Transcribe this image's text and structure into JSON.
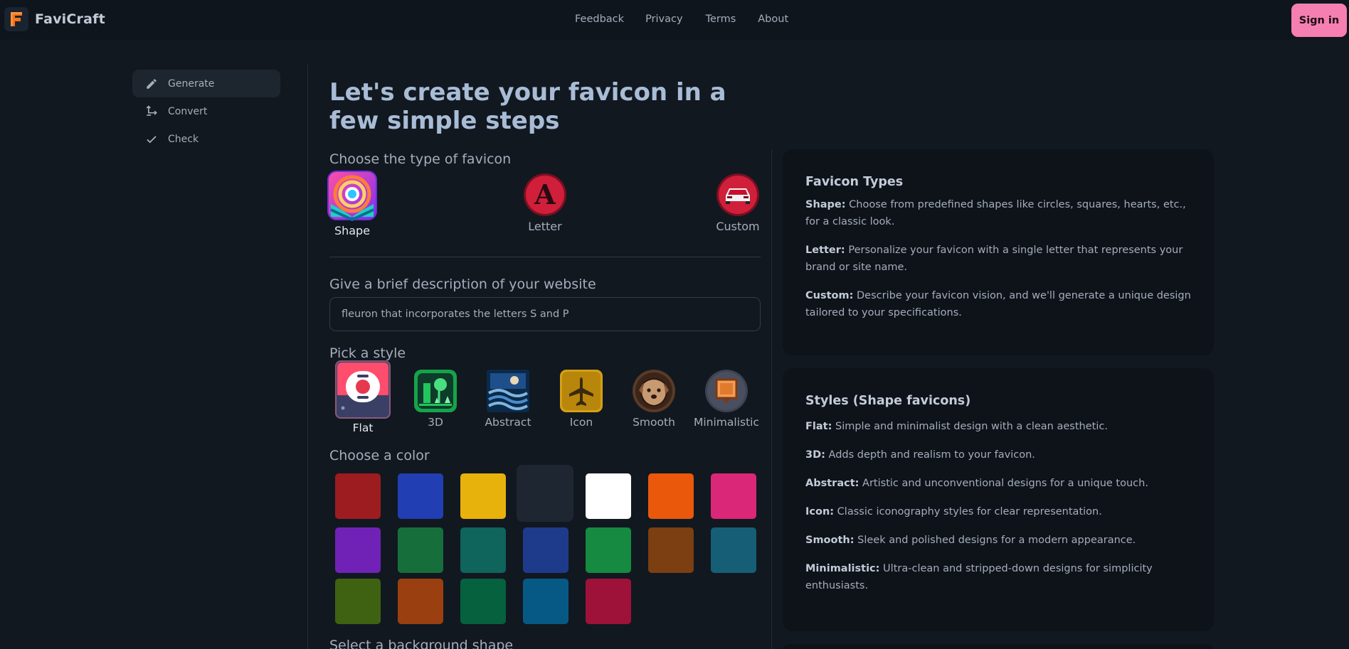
{
  "app": {
    "name": "FaviCraft"
  },
  "nav": {
    "links": [
      "Feedback",
      "Privacy",
      "Terms",
      "About"
    ],
    "signin": "Sign in"
  },
  "sidebar": {
    "items": [
      {
        "label": "Generate",
        "icon": "pencil-icon",
        "active": true
      },
      {
        "label": "Convert",
        "icon": "convert-arrows-icon",
        "active": false
      },
      {
        "label": "Check",
        "icon": "check-icon",
        "active": false
      }
    ]
  },
  "main": {
    "title": "Let's create your favicon in a few simple steps",
    "type_label": "Choose the type of favicon",
    "types": [
      {
        "label": "Shape",
        "selected": true
      },
      {
        "label": "Letter",
        "selected": false
      },
      {
        "label": "Custom",
        "selected": false
      }
    ],
    "description_label": "Give a brief description of your website",
    "description_value": "fleuron that incorporates the letters S and P",
    "style_label": "Pick a style",
    "styles": [
      {
        "label": "Flat",
        "selected": true
      },
      {
        "label": "3D",
        "selected": false
      },
      {
        "label": "Abstract",
        "selected": false
      },
      {
        "label": "Icon",
        "selected": false
      },
      {
        "label": "Smooth",
        "selected": false
      },
      {
        "label": "Minimalistic",
        "selected": false
      }
    ],
    "color_label": "Choose a color",
    "colors": [
      "#9d1c20",
      "#213eb3",
      "#e8b20c",
      "#1e2631",
      "#ffffff",
      "#ea580c",
      "#db2777",
      "#7022b6",
      "#166f3b",
      "#0f645c",
      "#1e3a8a",
      "#158a40",
      "#7b3f12",
      "#165e76",
      "#3f6212",
      "#9a3f0f",
      "#05613e",
      "#075985",
      "#9e1239"
    ],
    "selected_color": "#1e2631",
    "bg_shape_label": "Select a background shape"
  },
  "panel": {
    "types": {
      "title": "Favicon Types",
      "items": [
        {
          "term": "Shape:",
          "text": " Choose from predefined shapes like circles, squares, hearts, etc., for a classic look."
        },
        {
          "term": "Letter:",
          "text": " Personalize your favicon with a single letter that represents your brand or site name."
        },
        {
          "term": "Custom:",
          "text": " Describe your favicon vision, and we'll generate a unique design tailored to your specifications."
        }
      ]
    },
    "styles": {
      "title": "Styles (Shape favicons)",
      "items": [
        {
          "term": "Flat:",
          "text": " Simple and minimalist design with a clean aesthetic."
        },
        {
          "term": "3D:",
          "text": " Adds depth and realism to your favicon."
        },
        {
          "term": "Abstract:",
          "text": " Artistic and unconventional designs for a unique touch."
        },
        {
          "term": "Icon:",
          "text": " Classic iconography styles for clear representation."
        },
        {
          "term": "Smooth:",
          "text": " Sleek and polished designs for a modern appearance."
        },
        {
          "term": "Minimalistic:",
          "text": " Ultra-clean and stripped-down designs for simplicity enthusiasts."
        }
      ]
    }
  }
}
